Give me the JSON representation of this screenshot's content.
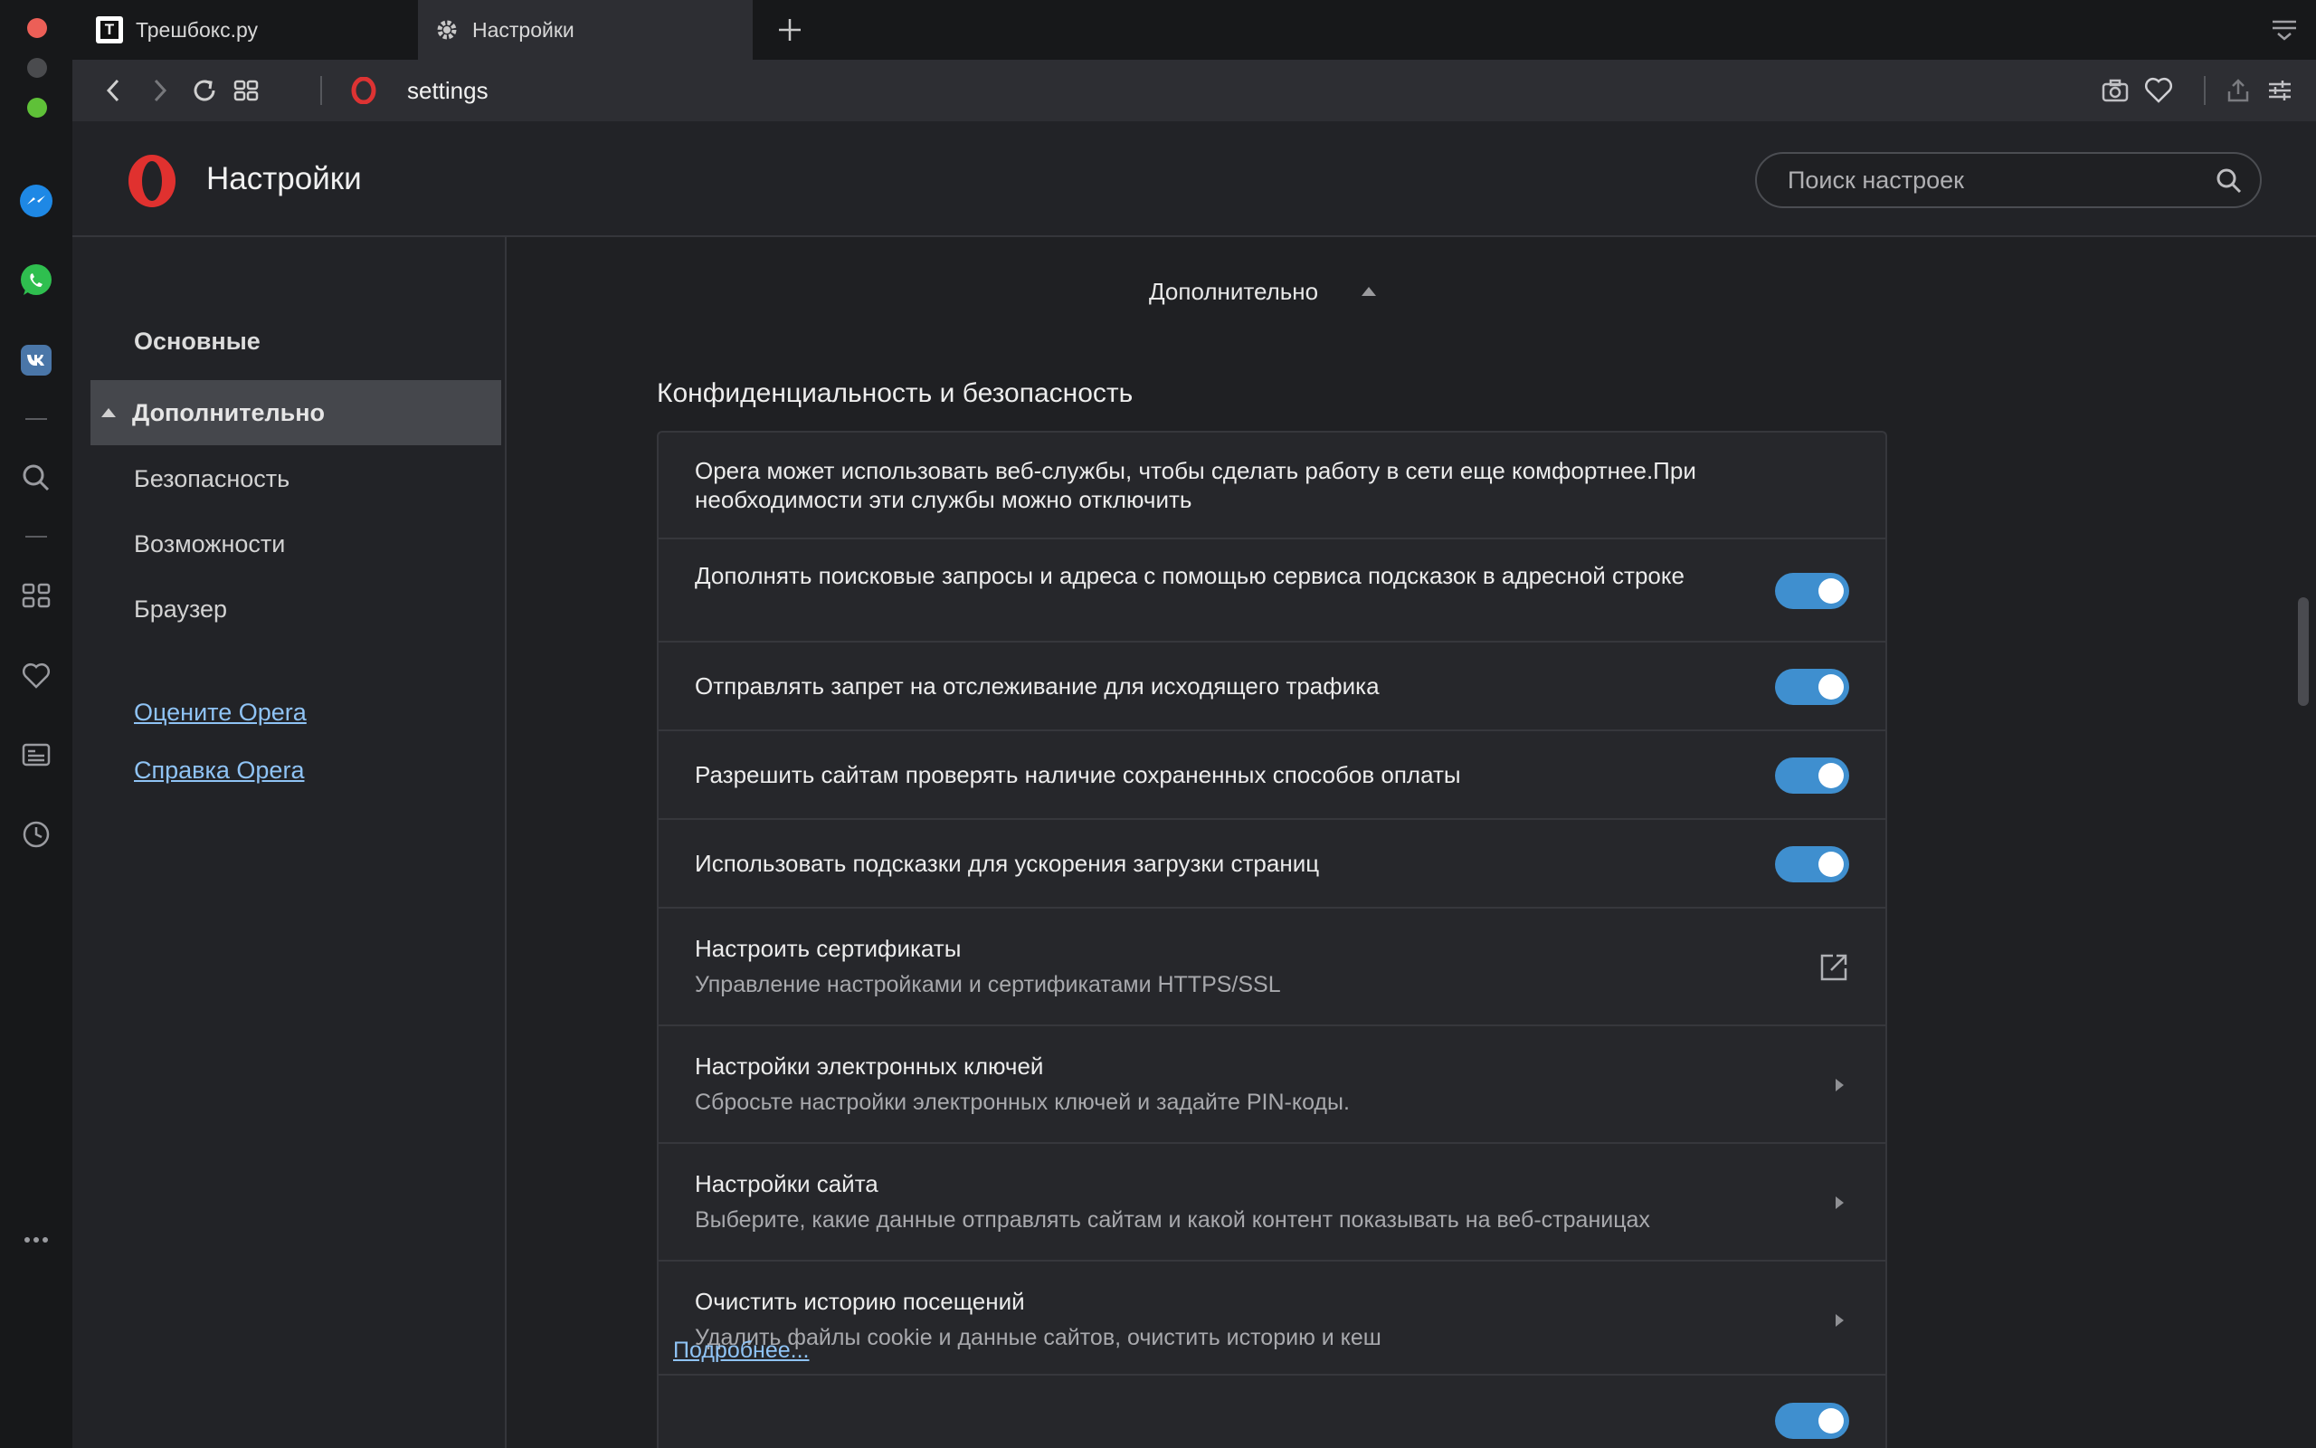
{
  "tabs": [
    {
      "label": "Трешбокс.ру",
      "favicon": "T"
    },
    {
      "label": "Настройки",
      "icon": "gear-icon"
    }
  ],
  "address": {
    "url": "settings"
  },
  "header": {
    "title": "Настройки"
  },
  "search": {
    "placeholder": "Поиск настроек"
  },
  "nav": {
    "basic": "Основные",
    "advanced": "Дополнительно",
    "security": "Безопасность",
    "features": "Возможности",
    "browser": "Браузер",
    "rate_link": "Оцените Opera",
    "help_link": "Справка Opera"
  },
  "main": {
    "advanced_toggle": "Дополнительно",
    "section_title": "Конфиденциальность и безопасность",
    "intro": "Opera может использовать веб-службы, чтобы сделать работу в сети еще комфортнее.При необходимости эти службы можно отключить",
    "toggles": [
      {
        "label": "Дополнять поисковые запросы и адреса с помощью сервиса подсказок в адресной строке",
        "on": true
      },
      {
        "label": "Отправлять запрет на отслеживание для исходящего трафика",
        "on": true
      },
      {
        "label": "Разрешить сайтам проверять наличие сохраненных способов оплаты",
        "on": true
      },
      {
        "label": "Использовать подсказки для ускорения загрузки страниц",
        "on": true
      }
    ],
    "links": [
      {
        "title": "Настроить сертификаты",
        "sub": "Управление настройками и сертификатами HTTPS/SSL",
        "icon": "external-link-icon"
      },
      {
        "title": "Настройки электронных ключей",
        "sub": "Сбросьте настройки электронных ключей и задайте PIN-коды.",
        "icon": "chevron-right-icon"
      },
      {
        "title": "Настройки сайта",
        "sub": "Выберите, какие данные отправлять сайтам и какой контент показывать на веб-страницах",
        "icon": "chevron-right-icon"
      },
      {
        "title": "Очистить историю посещений",
        "sub": "Удалить файлы cookie и данные сайтов, очистить историю и кеш",
        "icon": "chevron-right-icon"
      }
    ],
    "more_link": "Подробнее..."
  },
  "colors": {
    "accent": "#3f8fcf",
    "link": "#8fc3f5",
    "opera_red": "#e0312f"
  }
}
